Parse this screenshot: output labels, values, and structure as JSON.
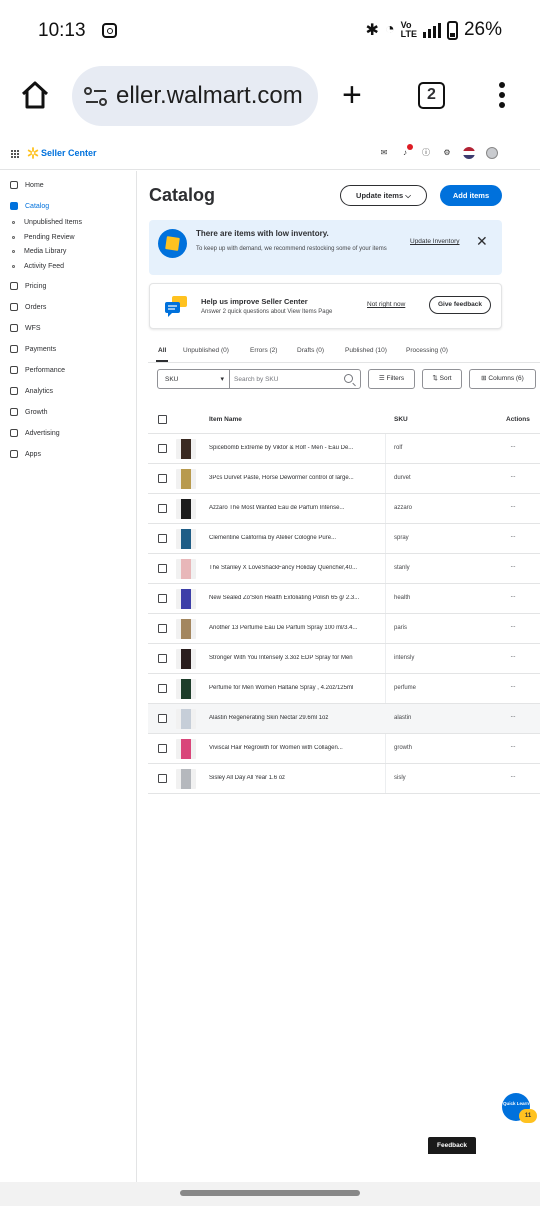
{
  "status_bar": {
    "time": "10:13",
    "battery": "26%"
  },
  "browser": {
    "url": "eller.walmart.com",
    "tab_count": "2"
  },
  "top_nav": {
    "brand": "Seller Center"
  },
  "sidebar": {
    "items": [
      {
        "label": "Home"
      },
      {
        "label": "Catalog",
        "active": true
      },
      {
        "label": "Pricing"
      },
      {
        "label": "Orders"
      },
      {
        "label": "WFS"
      },
      {
        "label": "Payments"
      },
      {
        "label": "Performance"
      },
      {
        "label": "Analytics"
      },
      {
        "label": "Growth"
      },
      {
        "label": "Advertising"
      },
      {
        "label": "Apps"
      }
    ],
    "catalog_sub": [
      "Unpublished Items",
      "Pending Review",
      "Media Library",
      "Activity Feed"
    ]
  },
  "page": {
    "title": "Catalog",
    "update_button": "Update items",
    "add_button": "Add items"
  },
  "alert": {
    "title": "There are items with low inventory.",
    "body": "To keep up with demand, we recommend restocking some of your items",
    "link": "Update Inventory"
  },
  "feedback_card": {
    "title": "Help us improve Seller Center",
    "body": "Answer 2 quick questions about View Items Page",
    "not_now": "Not right now",
    "give_feedback": "Give feedback"
  },
  "tabs": [
    "All",
    "Unpublished (0)",
    "Errors (2)",
    "Drafts (0)",
    "Published (10)",
    "Processing (0)"
  ],
  "filters": {
    "select_value": "SKU",
    "search_placeholder": "Search by SKU",
    "filters_label": "Filters",
    "sort_label": "Sort",
    "columns_label": "Columns (6)"
  },
  "table": {
    "headers": {
      "name": "Item Name",
      "sku": "SKU",
      "actions": "Actions"
    },
    "rows": [
      {
        "name": "Spicebomb Extreme by Viktor & Rolf - Men - Eau De...",
        "sku": "rolf",
        "thumb_color": "#3a2a22"
      },
      {
        "name": "3Pcs Durvet Paste, Horse Dewormer control of large...",
        "sku": "durvet",
        "thumb_color": "#b89a4e"
      },
      {
        "name": "Azzaro The Most Wanted Eau de Parfum Intense...",
        "sku": "azzaro",
        "thumb_color": "#1d1d1d"
      },
      {
        "name": "Clementine California by Atelier Cologne Pure...",
        "sku": "spray",
        "thumb_color": "#1f5d86"
      },
      {
        "name": "The Stanley X LoveShackFancy Holiday Quencher,40...",
        "sku": "stanly",
        "thumb_color": "#e8b7b9"
      },
      {
        "name": "New Sealed Zo'Skin Health Exfoliating Polish 65 g/ 2.3...",
        "sku": "health",
        "thumb_color": "#3d3fa8"
      },
      {
        "name": "Another 13 Perfume Eau De Parfum Spray 100 ml/3.4...",
        "sku": "paris",
        "thumb_color": "#a3865f"
      },
      {
        "name": "Stronger With You Intensely 3.3oz EDP Spray for Men",
        "sku": "intensly",
        "thumb_color": "#2a1e1e"
      },
      {
        "name": "Perfume for Men Women Haltane Spray , 4.2oz/125ml",
        "sku": "perfume",
        "thumb_color": "#1e3d2a"
      },
      {
        "name": "Alastin Regenerating Skin Nectar 29.6ml 1oz",
        "sku": "alastin",
        "thumb_color": "#c6ced8",
        "highlighted": true
      },
      {
        "name": "Viviscal Hair Regrowth for Women with Collagen...",
        "sku": "growth",
        "thumb_color": "#d9467a"
      },
      {
        "name": "Sisley All Day All Year 1.6 oz",
        "sku": "sisly",
        "thumb_color": "#b5b8bd"
      }
    ]
  },
  "quick_learn": {
    "label": "Quick Learn",
    "badge": "11"
  },
  "feedback_tab": "Feedback"
}
